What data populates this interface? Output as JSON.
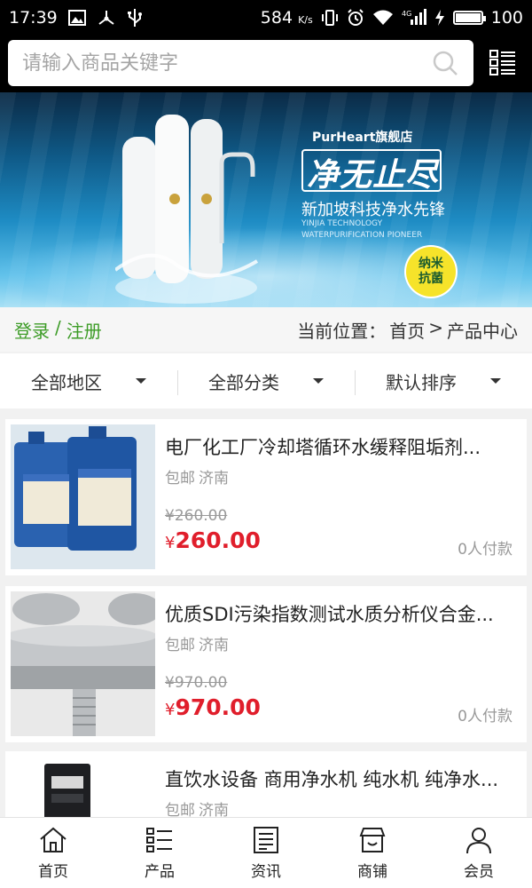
{
  "status_bar": {
    "time": "17:39",
    "speed": "584",
    "speed_unit": "K/s",
    "network": "4G",
    "battery": "100",
    "battery_level": 1.0
  },
  "search": {
    "placeholder": "请输入商品关键字"
  },
  "banner": {
    "brand": "PurHeart旗舰店",
    "slogan": "净无止尽",
    "subtitle": "新加坡科技净水先锋",
    "english": "YINJIA TECHNOLOGY WATERPURIFICATION PIONEER",
    "badge_line1": "纳米",
    "badge_line2": "抗菌"
  },
  "account": {
    "login": "登录",
    "separator": "/",
    "register": "注册"
  },
  "breadcrumb": {
    "prefix": "当前位置：",
    "home": "首页",
    "separator": ">",
    "current": "产品中心"
  },
  "filters": [
    {
      "label": "全部地区"
    },
    {
      "label": "全部分类"
    },
    {
      "label": "默认排序"
    }
  ],
  "products": [
    {
      "title": "电厂化工厂冷却塔循环水缓释阻垢剂...",
      "shipping": "包邮",
      "city": "济南",
      "original_price": "¥260.00",
      "currency": "¥",
      "price": "260.00",
      "sold": "0人付款"
    },
    {
      "title": "优质SDI污染指数测试水质分析仪合金...",
      "shipping": "包邮",
      "city": "济南",
      "original_price": "¥970.00",
      "currency": "¥",
      "price": "970.00",
      "sold": "0人付款"
    },
    {
      "title": "直饮水设备 商用净水机 纯水机 纯净水...",
      "shipping": "包邮",
      "city": "济南"
    }
  ],
  "tabs": [
    {
      "label": "首页",
      "icon": "home-icon"
    },
    {
      "label": "产品",
      "icon": "list-icon"
    },
    {
      "label": "资讯",
      "icon": "news-icon"
    },
    {
      "label": "商铺",
      "icon": "shop-icon"
    },
    {
      "label": "会员",
      "icon": "user-icon"
    }
  ]
}
